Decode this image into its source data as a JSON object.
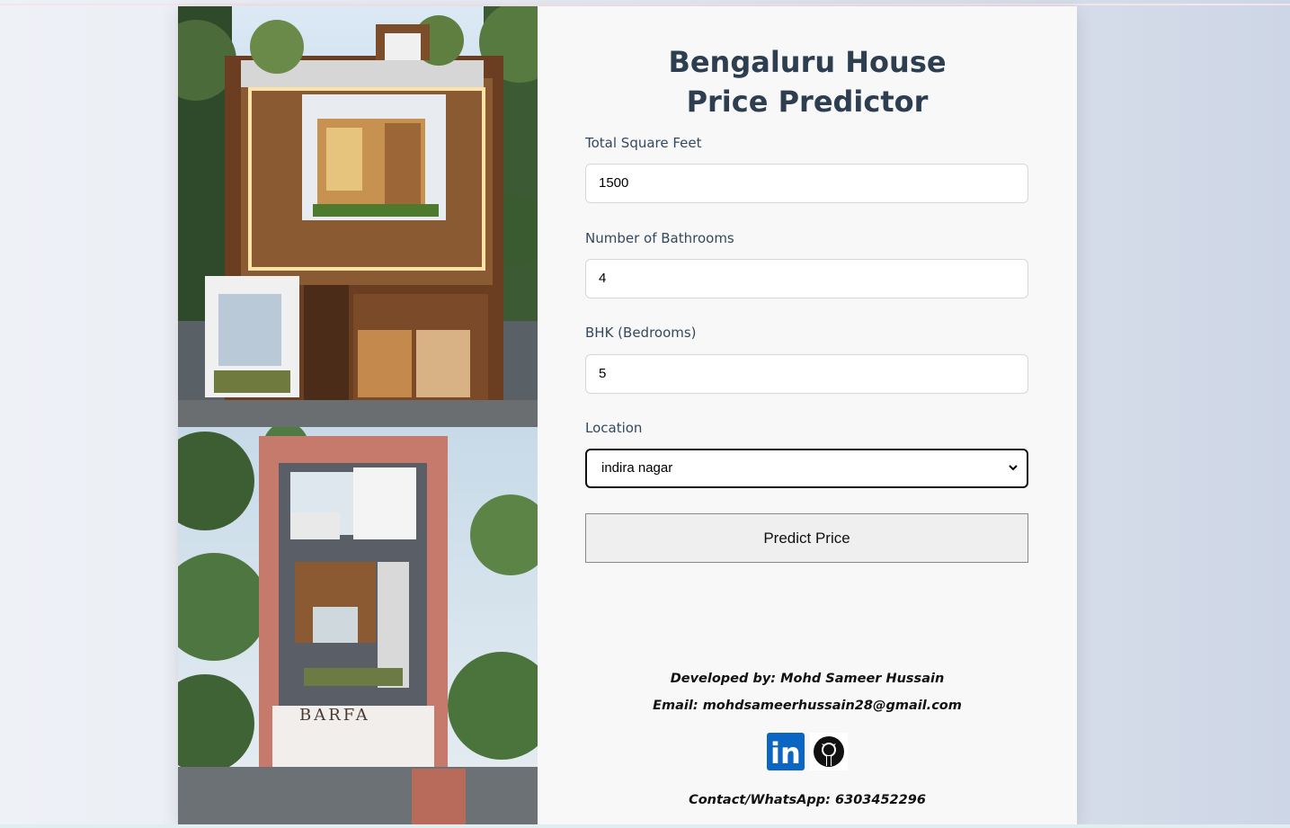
{
  "app": {
    "title": "Bengaluru House Price Predictor"
  },
  "form": {
    "sqft_label": "Total Square Feet",
    "sqft_value": "1500",
    "bath_label": "Number of Bathrooms",
    "bath_value": "4",
    "bhk_label": "BHK (Bedrooms)",
    "bhk_value": "5",
    "location_label": "Location",
    "location_value": "indira nagar",
    "predict_label": "Predict Price"
  },
  "footer": {
    "developer": "Developed by: Mohd Sameer Hussain",
    "email": "Email: mohdsameerhussain28@gmail.com",
    "contact": "Contact/WhatsApp: 6303452296",
    "linkedin_text": "in"
  },
  "images": {
    "bottom_sign": "BARFA"
  },
  "colors": {
    "title": "#2c3e50",
    "linkedin": "#0a66c2"
  },
  "icons": {
    "linkedin": "linkedin-icon",
    "github": "github-icon",
    "select_chevron": "chevron-down-icon"
  }
}
